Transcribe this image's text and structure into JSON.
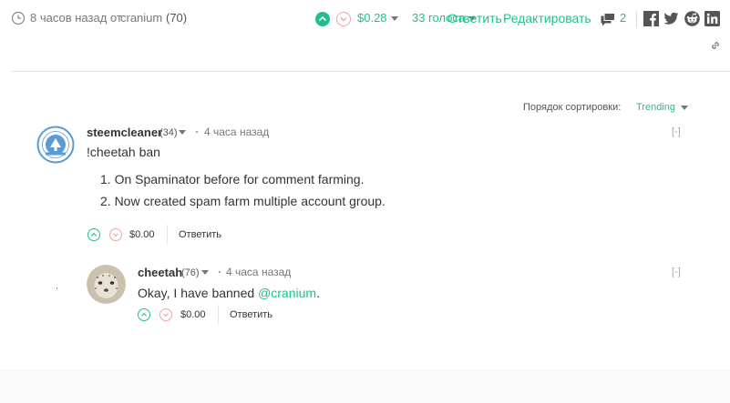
{
  "post_meta": {
    "time_ago": "8 часов назад от",
    "author": "cranium",
    "author_rep": "(70)",
    "payout": "$0.28",
    "votes": "33 голоса",
    "reply_label": "Ответить",
    "edit_label": "Редактировать",
    "comment_count": "2"
  },
  "sort": {
    "label": "Порядок сортировки:",
    "value": "Trending"
  },
  "comments": [
    {
      "author": "steemcleaner",
      "rep": "(34)",
      "time_ago": "4 часа назад",
      "collapse": "[-]",
      "body_first": "!cheetah ban",
      "list": [
        "1. On Spaminator before for comment farming.",
        "2. Now created spam farm multiple account group."
      ],
      "payout": "$0.00",
      "reply_label": "Ответить"
    },
    {
      "author": "cheetah",
      "rep": "(76)",
      "time_ago": "4 часа назад",
      "collapse": "[-]",
      "body_prefix": "Okay, I have banned ",
      "mention": "@cranium",
      "body_suffix": ".",
      "payout": "$0.00",
      "reply_label": "Ответить"
    }
  ],
  "icons": {
    "clock": "clock-icon",
    "vote_up": "chevron-up-icon",
    "vote_down": "chevron-down-icon",
    "comments": "comments-icon",
    "facebook": "facebook-icon",
    "twitter": "twitter-icon",
    "reddit": "reddit-icon",
    "linkedin": "linkedin-icon",
    "permalink": "link-icon"
  },
  "colors": {
    "accent": "#1fbf8f",
    "downvote": "#f5a1a1",
    "text": "#333333",
    "muted": "#777777"
  }
}
